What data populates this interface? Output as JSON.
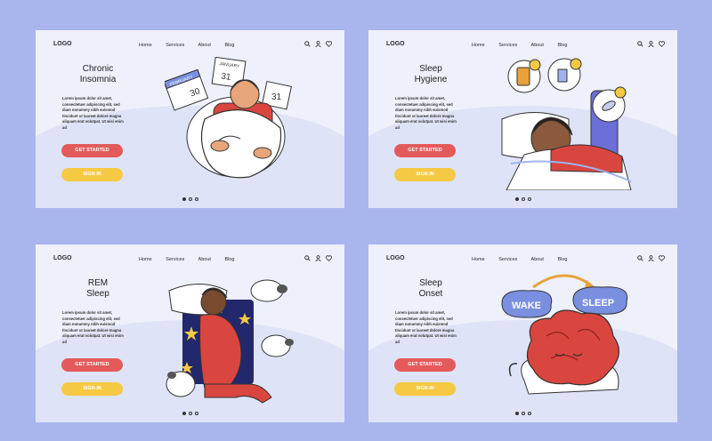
{
  "nav": {
    "logo": "LOGO",
    "links": [
      "Home",
      "Services",
      "About",
      "Blog"
    ]
  },
  "panels": [
    {
      "title_line1": "Chronic",
      "title_line2": "Insomnia",
      "body": "Lorem ipsum dolor sit amet, consectetuer adipiscing elit, sed diam nonummy nibh euismod tincidunt ut laoreet dolore magna aliquam erat volutpat. Ut wisi enim ad",
      "start_label": "GET STARTED",
      "sign_label": "SIGN IN",
      "calendar_labels": [
        "FEBRUARY",
        "30",
        "JANUARY",
        "31",
        "31"
      ]
    },
    {
      "title_line1": "Sleep",
      "title_line2": "Hygiene",
      "body": "Lorem ipsum dolor sit amet, consectetuer adipiscing elit, sed diam nonummy nibh euismod tincidunt ut laoreet dolore magna aliquam erat volutpat. Ut wisi enim ad",
      "start_label": "GET STARTED",
      "sign_label": "SIGN IN"
    },
    {
      "title_line1": "REM",
      "title_line2": "Sleep",
      "body": "Lorem ipsum dolor sit amet, consectetuer adipiscing elit, sed diam nonummy nibh euismod tincidunt ut laoreet dolore magna aliquam erat volutpat. Ut wisi enim ad",
      "start_label": "GET STARTED",
      "sign_label": "SIGN IN"
    },
    {
      "title_line1": "Sleep",
      "title_line2": "Onset",
      "body": "Lorem ipsum dolor sit amet, consectetuer adipiscing elit, sed diam nonummy nibh euismod tincidunt ut laoreet dolore magna aliquam erat volutpat. Ut wisi enim ad",
      "start_label": "GET STARTED",
      "sign_label": "SIGN IN",
      "bubble_wake": "WAKE",
      "bubble_sleep": "SLEEP"
    }
  ],
  "colors": {
    "background": "#a9b6ee",
    "panel": "#eef0fb",
    "start_button": "#e45a5a",
    "sign_button": "#f6c944"
  },
  "icons": [
    "search-icon",
    "user-icon",
    "heart-icon"
  ],
  "pagination": {
    "count": 3,
    "active": 1
  }
}
